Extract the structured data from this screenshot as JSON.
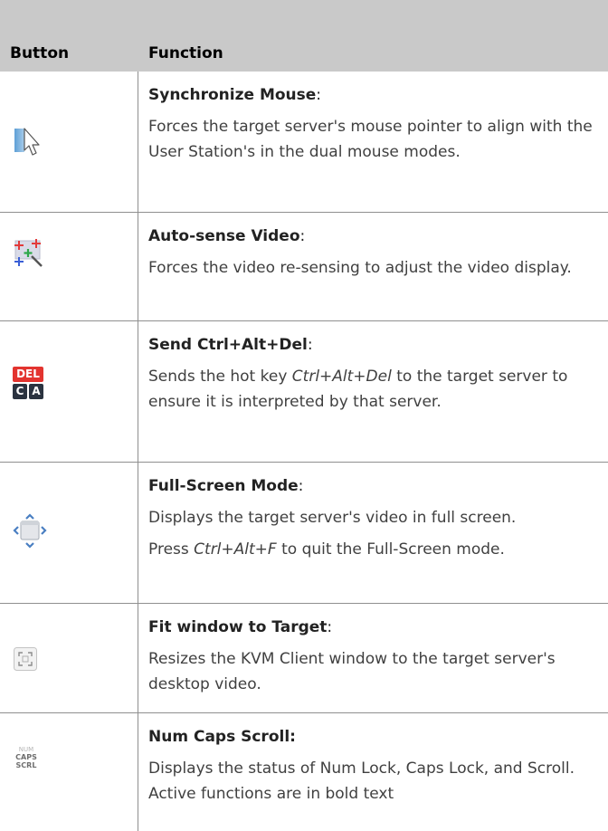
{
  "header": {
    "button_label": "Button",
    "function_label": "Function"
  },
  "rows": [
    {
      "icon": "synchronize-mouse-icon",
      "title": "Synchronize Mouse",
      "title_suffix": ":",
      "desc": "Forces the target server's mouse pointer to align with the User Station's in the dual mouse modes."
    },
    {
      "icon": "auto-sense-video-icon",
      "title": "Auto-sense Video",
      "title_suffix": ":",
      "desc": "Forces the video re-sensing to adjust the video display."
    },
    {
      "icon": "ctrl-alt-del-icon",
      "icon_text": {
        "del": "DEL",
        "c": "C",
        "a": "A"
      },
      "title": "Send Ctrl+Alt+Del",
      "title_suffix": ":",
      "desc_pre": "Sends the hot key ",
      "desc_em": "Ctrl+Alt+Del",
      "desc_post": " to the target server to ensure it is interpreted by that server."
    },
    {
      "icon": "full-screen-mode-icon",
      "title": "Full-Screen Mode",
      "title_suffix": ":",
      "desc": "Displays the target server's video in full screen.",
      "desc2_pre": "Press ",
      "desc2_em": "Ctrl+Alt+F",
      "desc2_post": " to quit the Full-Screen mode."
    },
    {
      "icon": "fit-window-icon",
      "title": "Fit window to Target",
      "title_suffix": ":",
      "desc": "Resizes the KVM Client window to the target server's desktop video."
    },
    {
      "icon": "num-caps-scroll-icon",
      "icon_text": {
        "num": "NUM",
        "caps": "CAPS",
        "scrl": "SCRL"
      },
      "title": "Num Caps Scroll:",
      "desc": "Displays the status of Num Lock, Caps Lock, and Scroll. Active functions are in bold text"
    }
  ]
}
